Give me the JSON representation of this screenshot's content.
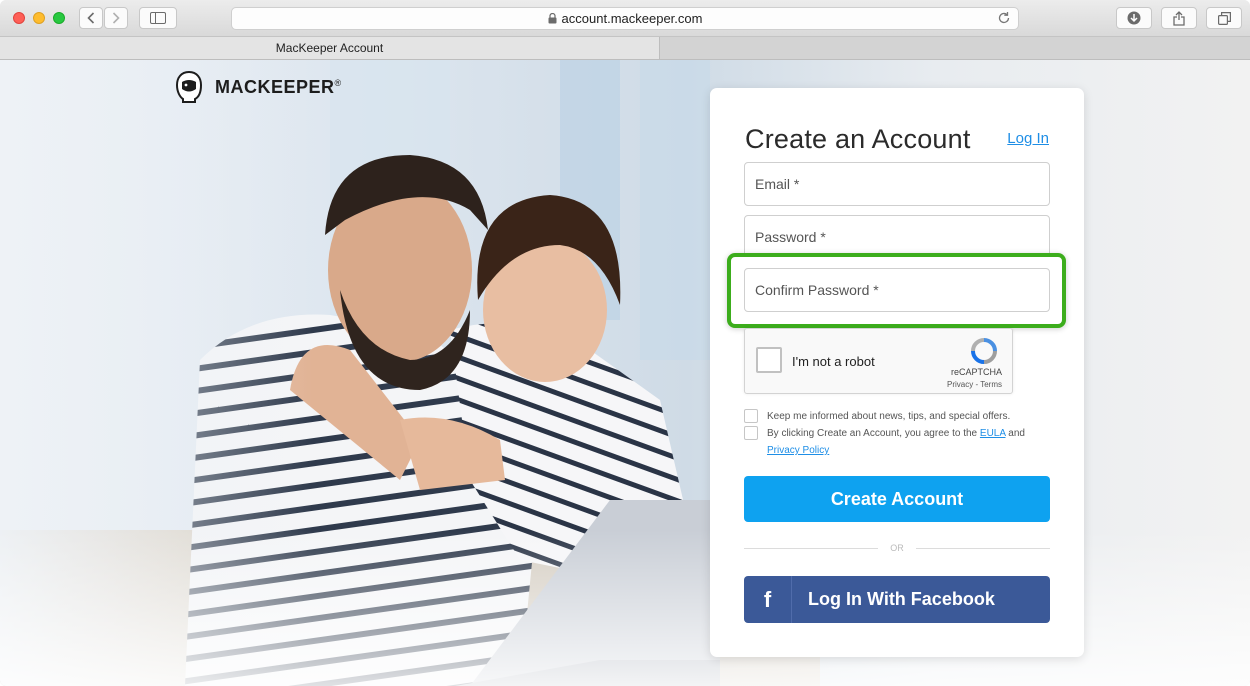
{
  "browser": {
    "url": "account.mackeeper.com",
    "tab_title": "MacKeeper Account"
  },
  "logo": {
    "text": "MACKEEPER",
    "registered": "®"
  },
  "form": {
    "title": "Create an Account",
    "login_link": "Log In",
    "email_placeholder": "Email *",
    "password_placeholder": "Password *",
    "confirm_password_placeholder": "Confirm Password *",
    "captcha": {
      "label": "I'm not a robot",
      "brand": "reCAPTCHA",
      "terms": "Privacy - Terms"
    },
    "newsletter_label": "Keep me informed about news, tips, and special offers.",
    "agree_prefix": "By clicking Create an Account, you agree to the",
    "eula_link": "EULA",
    "agree_and": "and",
    "privacy_link": "Privacy Policy",
    "create_button": "Create Account",
    "or_text": "OR",
    "facebook_button": "Log In With Facebook",
    "facebook_icon": "f"
  },
  "colors": {
    "accent_blue": "#0ea2f0",
    "facebook_blue": "#3b5998",
    "highlight_green": "#3cad1c",
    "link_blue": "#1e8ee6"
  }
}
